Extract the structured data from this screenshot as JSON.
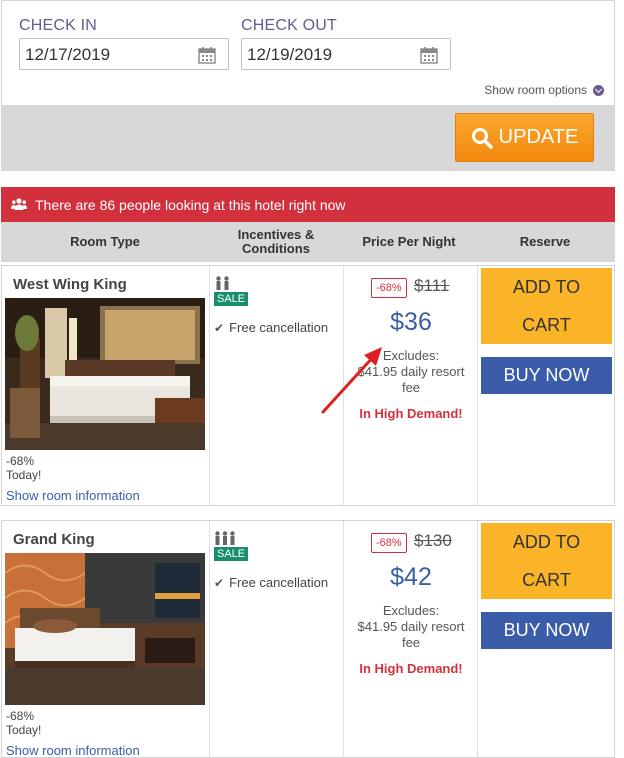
{
  "search": {
    "check_in_label": "CHECK IN",
    "check_in_value": "12/17/2019",
    "check_out_label": "CHECK OUT",
    "check_out_value": "12/19/2019",
    "room_options": "Show room options",
    "update_label": "UPDATE"
  },
  "alert": {
    "text": "There are 86 people looking at this hotel right now"
  },
  "table": {
    "headers": [
      "Room Type",
      "Incentives &\nConditions",
      "Price Per Night",
      "Reserve"
    ]
  },
  "rooms": [
    {
      "name": "West Wing King",
      "discount": "-68%",
      "today": "Today!",
      "show_info": "Show room information",
      "sale": "SALE",
      "cancellation": "Free cancellation",
      "badge": "-68%",
      "old_price": "$111",
      "price": "$36",
      "excludes_1": "Excludes:",
      "excludes_2": "$41.95 daily resort",
      "excludes_3": "fee",
      "demand": "In High Demand!",
      "add_to_cart": "ADD TO\nCART",
      "buy_now": "BUY NOW"
    },
    {
      "name": "Grand King",
      "discount": "-68%",
      "today": "Today!",
      "show_info": "Show room information",
      "sale": "SALE",
      "cancellation": "Free cancellation",
      "badge": "-68%",
      "old_price": "$130",
      "price": "$42",
      "excludes_1": "Excludes:",
      "excludes_2": "$41.95 daily resort",
      "excludes_3": "fee",
      "demand": "In High Demand!",
      "add_to_cart": "ADD TO\nCART",
      "buy_now": "BUY NOW"
    }
  ],
  "colors": {
    "accent_purple": "#6b5a8e",
    "alert_red": "#d2303d",
    "update_orange": "#f7941d",
    "cart_yellow": "#fbb427",
    "buy_blue": "#3b5ca8",
    "sale_green": "#178f6c"
  }
}
